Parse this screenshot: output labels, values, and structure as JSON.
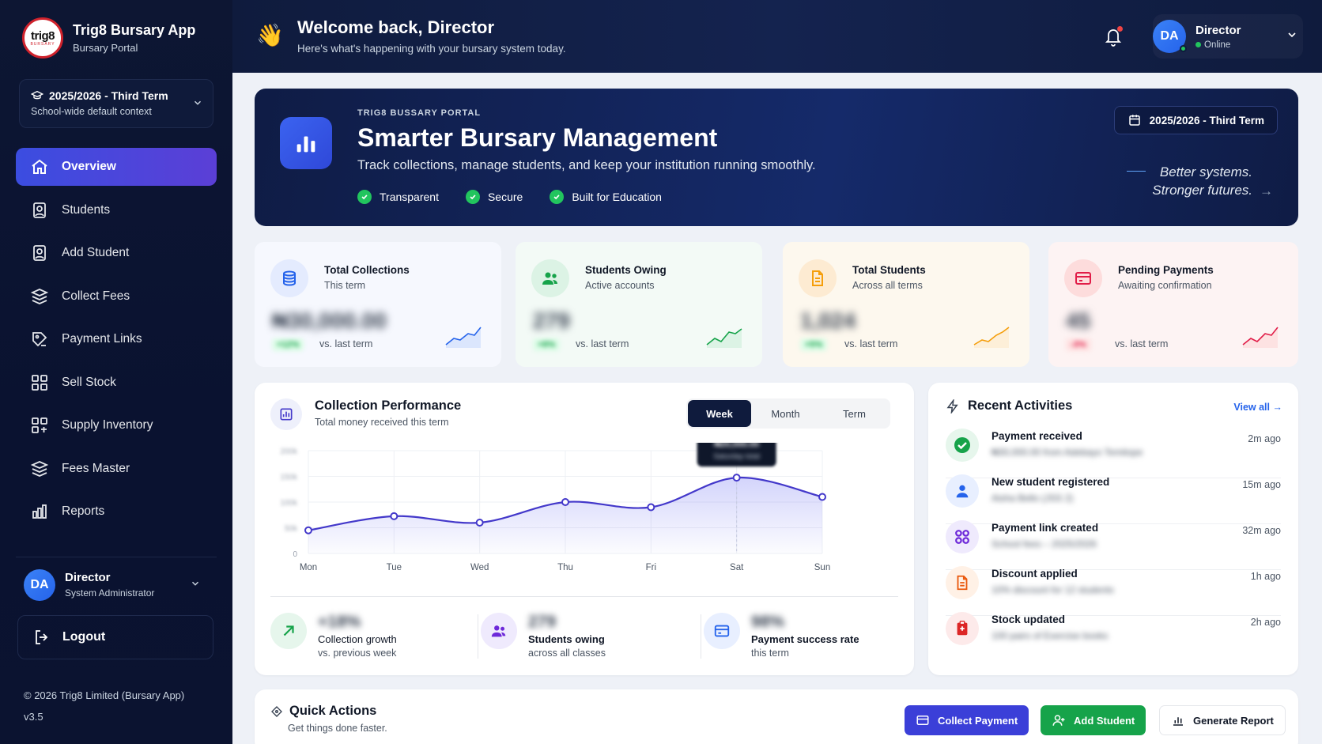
{
  "brand": {
    "logo_top": "trig8",
    "logo_bottom": "BURSARY",
    "name": "Trig8 Bursary App",
    "sub": "Bursary Portal"
  },
  "term_box": {
    "title": "2025/2026 - Third Term",
    "sub": "School-wide default context"
  },
  "nav": [
    {
      "label": "Overview",
      "icon": "home-icon",
      "active": true
    },
    {
      "label": "Students",
      "icon": "student-icon"
    },
    {
      "label": "Add Student",
      "icon": "add-student-icon"
    },
    {
      "label": "Collect Fees",
      "icon": "collect-fees-icon"
    },
    {
      "label": "Payment Links",
      "icon": "payment-link-icon"
    },
    {
      "label": "Sell Stock",
      "icon": "sell-stock-icon"
    },
    {
      "label": "Supply Inventory",
      "icon": "supply-inventory-icon"
    },
    {
      "label": "Fees Master",
      "icon": "fees-master-icon"
    },
    {
      "label": "Reports",
      "icon": "reports-icon"
    }
  ],
  "side_user": {
    "initials": "DA",
    "name": "Director",
    "role": "System Administrator"
  },
  "logout": "Logout",
  "copyright": "© 2026 Trig8 Limited (Bursary App)",
  "version": "v3.5",
  "topbar": {
    "wave": "👋",
    "welcome": "Welcome back, Director",
    "sub": "Here's what's happening with your bursary system today.",
    "user_initials": "DA",
    "user_name": "Director",
    "user_status": "Online"
  },
  "hero": {
    "kicker": "TRIG8 BUSSARY PORTAL",
    "title": "Smarter Bursary Management",
    "desc": "Track collections, manage students, and keep your institution running smoothly.",
    "badges": [
      "Transparent",
      "Secure",
      "Built for Education"
    ],
    "term": "2025/2026 - Third Term",
    "motto_1": "Better systems.",
    "motto_2": "Stronger futures."
  },
  "stats": [
    {
      "title": "Total Collections",
      "sub": "This term",
      "value": "₦30,000.00",
      "change": "+12%",
      "vs": "vs. last term",
      "color": "#2563eb",
      "bg": "#f5f7ff"
    },
    {
      "title": "Students Owing",
      "sub": "Active accounts",
      "value": "279",
      "change": "+8%",
      "vs": "vs. last term",
      "color": "#16a34a",
      "bg": "#f2f9f5"
    },
    {
      "title": "Total Students",
      "sub": "Across all terms",
      "value": "1,024",
      "change": "+5%",
      "vs": "vs. last term",
      "color": "#f59e0b",
      "bg": "#fdf8ef"
    },
    {
      "title": "Pending Payments",
      "sub": "Awaiting confirmation",
      "value": "45",
      "change": "-3%",
      "vs": "vs. last term",
      "color": "#e11d48",
      "bg": "#fdf2f3"
    }
  ],
  "performance": {
    "title": "Collection Performance",
    "sub": "Total money received this term",
    "tabs": [
      "Week",
      "Month",
      "Term"
    ],
    "active_tab": "Week",
    "tooltip_1": "₦20,000.00",
    "tooltip_2": "Saturday total",
    "kpis": [
      {
        "value": "+18%",
        "label": "Collection growth",
        "sub": "vs. previous week"
      },
      {
        "value": "279",
        "label": "Students owing",
        "sub": "across all classes"
      },
      {
        "value": "98%",
        "label": "Payment success rate",
        "sub": "this term"
      }
    ]
  },
  "chart_data": {
    "type": "area",
    "categories": [
      "Mon",
      "Tue",
      "Wed",
      "Thu",
      "Fri",
      "Sat",
      "Sun"
    ],
    "series": [
      {
        "values": [
          9,
          14.5,
          12,
          20,
          18,
          29.5,
          22
        ]
      }
    ],
    "yticks": [
      "200k",
      "150k",
      "100k",
      "50k",
      "0"
    ],
    "ylim": [
      0,
      40
    ],
    "grid": true,
    "color": "#4338ca"
  },
  "activities": {
    "title": "Recent Activities",
    "view_all": "View all",
    "items": [
      {
        "title": "Payment received",
        "desc": "₦30,000.00 from Adebayo Temitope",
        "time": "2m ago",
        "color": "#16a34a",
        "bg": "#e6f6ec"
      },
      {
        "title": "New student registered",
        "desc": "Aisha Bello (JSS 2)",
        "time": "15m ago",
        "color": "#2563eb",
        "bg": "#e8efff"
      },
      {
        "title": "Payment link created",
        "desc": "School fees – 2025/2026",
        "time": "32m ago",
        "color": "#6d28d9",
        "bg": "#efeafd"
      },
      {
        "title": "Discount applied",
        "desc": "10% discount for 12 students",
        "time": "1h ago",
        "color": "#ea580c",
        "bg": "#fff1e6"
      },
      {
        "title": "Stock updated",
        "desc": "100 pairs of Exercise books",
        "time": "2h ago",
        "color": "#dc2626",
        "bg": "#fdeaea"
      }
    ]
  },
  "quick": {
    "title": "Quick Actions",
    "sub": "Get things done faster.",
    "buttons": [
      {
        "label": "Collect Payment",
        "color": "#3b3fd8"
      },
      {
        "label": "Add Student",
        "color": "#16a34a"
      },
      {
        "label": "Generate Report",
        "color": "#ffffff"
      }
    ]
  }
}
